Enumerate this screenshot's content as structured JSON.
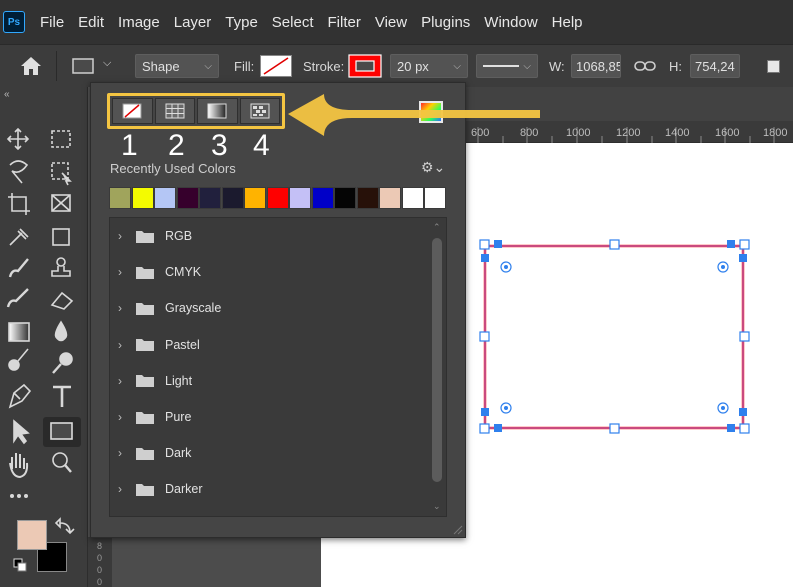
{
  "app": {
    "logo": "Ps"
  },
  "menu": [
    "File",
    "Edit",
    "Image",
    "Layer",
    "Type",
    "Select",
    "Filter",
    "View",
    "Plugins",
    "Window",
    "Help"
  ],
  "options_bar": {
    "mode_value": "Shape",
    "fill_label": "Fill:",
    "stroke_label": "Stroke:",
    "stroke_width": "20 px",
    "w_label": "W:",
    "w_value": "1068,85",
    "h_label": "H:",
    "h_value": "754,24",
    "stroke_color": "#ff0000"
  },
  "ruler": {
    "ticks": [
      "600",
      "800",
      "1000",
      "1200",
      "1400",
      "1600",
      "1800"
    ]
  },
  "swatch_panel": {
    "mode_buttons": [
      {
        "name": "no-color-icon",
        "number": "1"
      },
      {
        "name": "swatches-grid-icon",
        "number": "2"
      },
      {
        "name": "gradient-icon",
        "number": "3"
      },
      {
        "name": "pattern-icon",
        "number": "4"
      }
    ],
    "recent_label": "Recently Used Colors",
    "recent_colors": [
      "#a0a45c",
      "#f4fb00",
      "#b4c6f5",
      "#36002c",
      "#21203d",
      "#1b1a2e",
      "#ffb300",
      "#ff0000",
      "#c4c0f6",
      "#0000c8",
      "#050505",
      "#271109",
      "#ecc9b5",
      "#ffffff",
      "#ffffff"
    ],
    "folders": [
      "RGB",
      "CMYK",
      "Grayscale",
      "Pastel",
      "Light",
      "Pure",
      "Dark",
      "Darker"
    ]
  },
  "colors": {
    "foreground": "#ecc9b5",
    "background": "#000000",
    "annotation": "#f4c542",
    "selection": "#2f80ed"
  }
}
